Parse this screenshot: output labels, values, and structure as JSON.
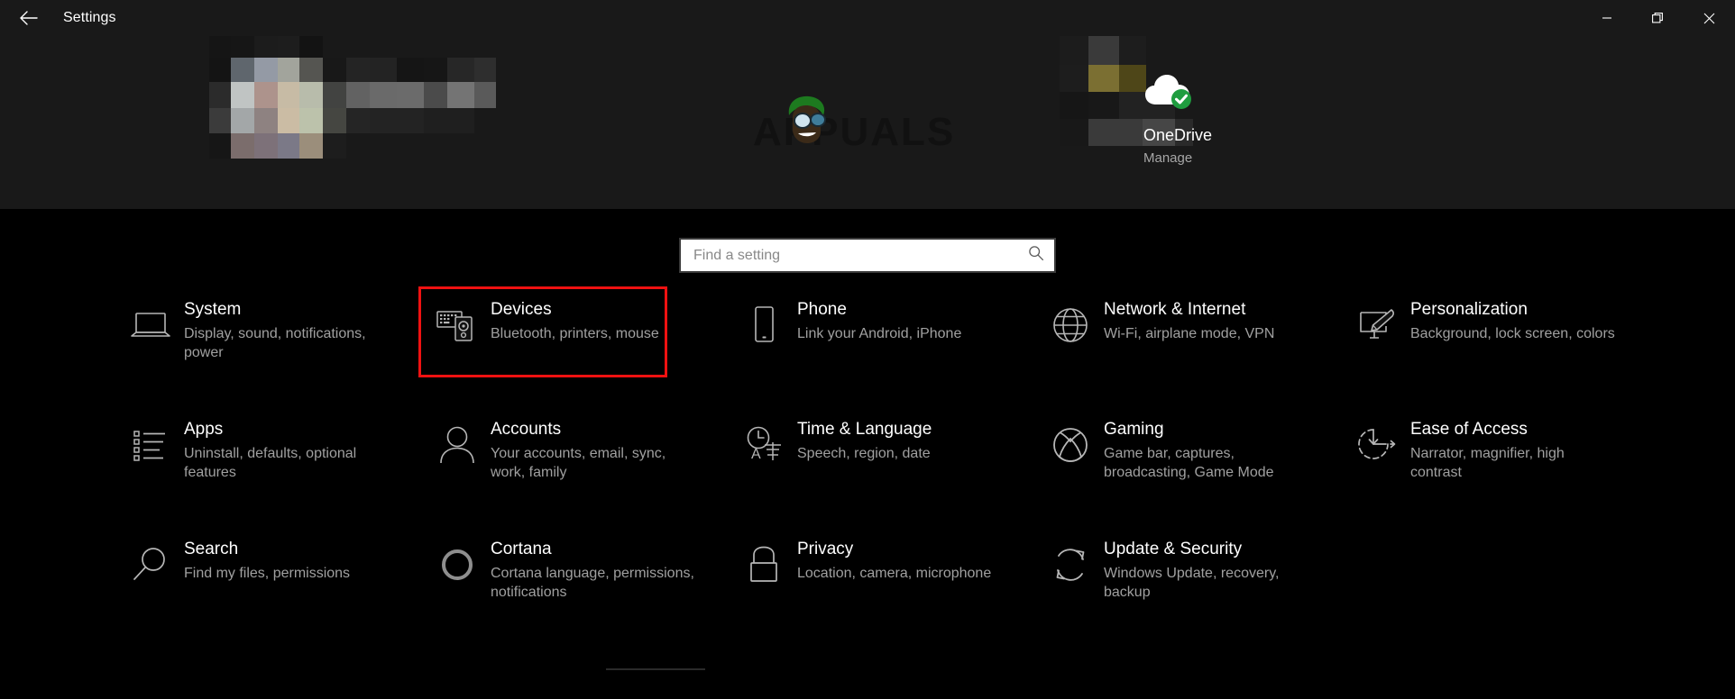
{
  "window": {
    "title": "Settings",
    "back_icon": "back-arrow-icon",
    "minimize_label": "Minimize",
    "maximize_label": "Maximize",
    "close_label": "Close"
  },
  "header": {
    "watermark_text": "APPUALS",
    "account": {
      "name": "OneDrive",
      "action": "Manage",
      "icon": "onedrive-cloud-icon",
      "status_icon": "green-check-icon",
      "status_color": "#1f9d3f"
    }
  },
  "search": {
    "placeholder": "Find a setting",
    "value": "",
    "icon": "search-icon"
  },
  "colors": {
    "background": "#000000",
    "header_background": "#191919",
    "title_text": "#ffffff",
    "subtitle_text": "#a0a0a0",
    "highlight_border": "#ef1111"
  },
  "highlight": {
    "target": "Devices",
    "color": "#ef1111"
  },
  "tiles": [
    [
      {
        "title": "System",
        "subtitle": "Display, sound, notifications, power",
        "icon": "laptop-icon",
        "highlighted": false
      },
      {
        "title": "Devices",
        "subtitle": "Bluetooth, printers, mouse",
        "icon": "devices-icon",
        "highlighted": true
      },
      {
        "title": "Phone",
        "subtitle": "Link your Android, iPhone",
        "icon": "phone-icon",
        "highlighted": false
      },
      {
        "title": "Network & Internet",
        "subtitle": "Wi-Fi, airplane mode, VPN",
        "icon": "globe-icon",
        "highlighted": false
      },
      {
        "title": "Personalization",
        "subtitle": "Background, lock screen, colors",
        "icon": "personalization-brush-icon",
        "highlighted": false
      }
    ],
    [
      {
        "title": "Apps",
        "subtitle": "Uninstall, defaults, optional features",
        "icon": "apps-list-icon",
        "highlighted": false
      },
      {
        "title": "Accounts",
        "subtitle": "Your accounts, email, sync, work, family",
        "icon": "person-icon",
        "highlighted": false
      },
      {
        "title": "Time & Language",
        "subtitle": "Speech, region, date",
        "icon": "clock-language-icon",
        "highlighted": false
      },
      {
        "title": "Gaming",
        "subtitle": "Game bar, captures, broadcasting, Game Mode",
        "icon": "xbox-icon",
        "highlighted": false
      },
      {
        "title": "Ease of Access",
        "subtitle": "Narrator, magnifier, high contrast",
        "icon": "ease-of-access-icon",
        "highlighted": false
      }
    ],
    [
      {
        "title": "Search",
        "subtitle": "Find my files, permissions",
        "icon": "magnifier-icon",
        "highlighted": false
      },
      {
        "title": "Cortana",
        "subtitle": "Cortana language, permissions, notifications",
        "icon": "cortana-ring-icon",
        "highlighted": false
      },
      {
        "title": "Privacy",
        "subtitle": "Location, camera, microphone",
        "icon": "lock-icon",
        "highlighted": false
      },
      {
        "title": "Update & Security",
        "subtitle": "Windows Update, recovery, backup",
        "icon": "refresh-sync-icon",
        "highlighted": false
      }
    ]
  ]
}
